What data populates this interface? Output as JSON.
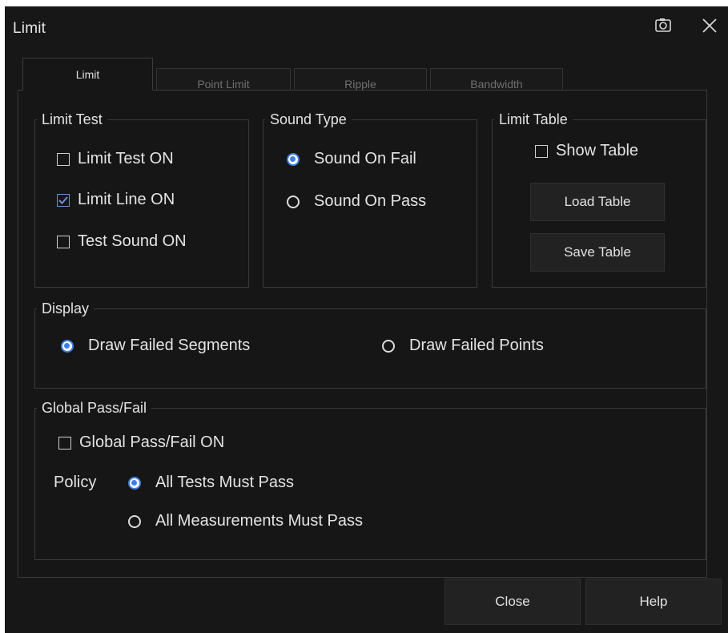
{
  "window": {
    "title": "Limit",
    "icons": {
      "camera": "camera-icon",
      "close": "close-icon"
    }
  },
  "tabs": [
    {
      "label": "Limit",
      "active": true
    },
    {
      "label": "Point Limit",
      "active": false
    },
    {
      "label": "Ripple",
      "active": false
    },
    {
      "label": "Bandwidth",
      "active": false
    }
  ],
  "limit_test": {
    "legend": "Limit Test",
    "limit_test_on": {
      "label": "Limit Test ON",
      "checked": false
    },
    "limit_line_on": {
      "label": "Limit Line ON",
      "checked": true
    },
    "test_sound_on": {
      "label": "Test Sound ON",
      "checked": false
    }
  },
  "sound_type": {
    "legend": "Sound Type",
    "on_fail": {
      "label": "Sound On Fail",
      "selected": true
    },
    "on_pass": {
      "label": "Sound On Pass",
      "selected": false
    }
  },
  "limit_table": {
    "legend": "Limit Table",
    "show_table": {
      "label": "Show Table",
      "checked": false
    },
    "load_label": "Load Table",
    "save_label": "Save Table"
  },
  "display": {
    "legend": "Display",
    "draw_failed_segments": {
      "label": "Draw Failed Segments",
      "selected": true
    },
    "draw_failed_points": {
      "label": "Draw Failed Points",
      "selected": false
    }
  },
  "global_pass_fail": {
    "legend": "Global Pass/Fail",
    "on": {
      "label": "Global Pass/Fail ON",
      "checked": false
    },
    "policy_label": "Policy",
    "all_tests_must_pass": {
      "label": "All Tests Must Pass",
      "selected": true
    },
    "all_measurements_must_pass": {
      "label": "All Measurements Must Pass",
      "selected": false
    }
  },
  "footer": {
    "close_label": "Close",
    "help_label": "Help"
  },
  "colors": {
    "background": "#171717",
    "accent": "#3d7fe0",
    "text": "#e4e4e4",
    "border": "#3a3a3a"
  }
}
